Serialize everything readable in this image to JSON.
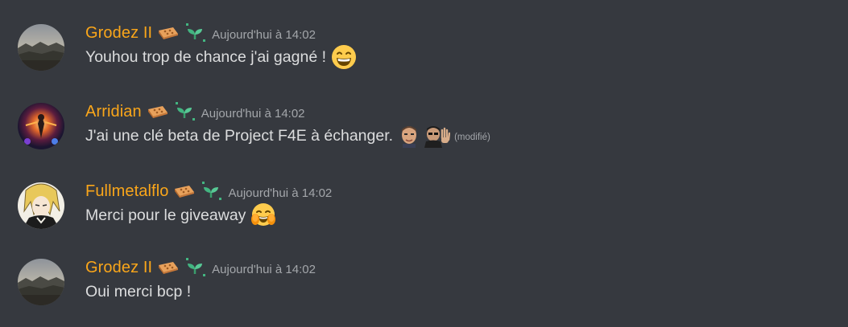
{
  "messages": [
    {
      "username": "Grodez II",
      "timestamp": "Aujourd'hui à 14:02",
      "text": "Youhou trop de chance j'ai gagné !",
      "avatar": "landscape-avatar",
      "emoji": "grinning-face-icon"
    },
    {
      "username": "Arridian",
      "timestamp": "Aujourd'hui à 14:02",
      "text": "J'ai une clé beta de Project F4E à échanger.",
      "avatar": "glowing-figure-avatar",
      "emoji": [
        "man-face-emote-icon",
        "waving-man-emote-icon"
      ],
      "edited": "(modifié)"
    },
    {
      "username": "Fullmetalflo",
      "timestamp": "Aujourd'hui à 14:02",
      "text": "Merci pour le giveaway",
      "avatar": "anime-character-avatar",
      "emoji": "face-with-hands-icon"
    },
    {
      "username": "Grodez II",
      "timestamp": "Aujourd'hui à 14:02",
      "text": "Oui merci bcp !",
      "avatar": "landscape-avatar"
    }
  ],
  "colors": {
    "background": "#36393f",
    "username": "#faa61a",
    "text": "#dcddde",
    "timestamp": "#a3a6aa",
    "sprout_badge": "#43b581"
  },
  "badges": [
    "brick-badge-icon",
    "sprout-badge-icon"
  ]
}
